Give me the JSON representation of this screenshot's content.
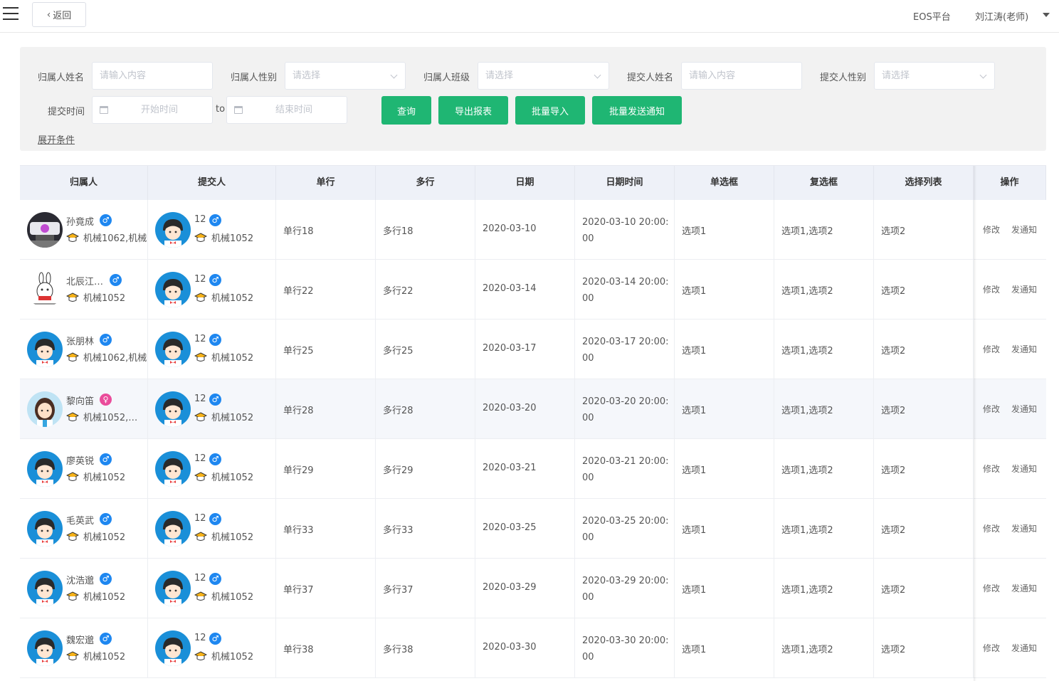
{
  "topbar": {
    "back_label": "返回",
    "platform": "EOS平台",
    "user": "刘江涛(老师)"
  },
  "filters": {
    "owner_name_label": "归属人姓名",
    "owner_name_placeholder": "请输入内容",
    "owner_gender_label": "归属人性别",
    "owner_gender_placeholder": "请选择",
    "owner_class_label": "归属人班级",
    "owner_class_placeholder": "请选择",
    "submitter_name_label": "提交人姓名",
    "submitter_name_placeholder": "请输入内容",
    "submitter_gender_label": "提交人性别",
    "submitter_gender_placeholder": "请选择",
    "submit_time_label": "提交时间",
    "start_placeholder": "开始时间",
    "to": "to",
    "end_placeholder": "结束时间",
    "expand_label": "展开条件"
  },
  "actions": {
    "query": "查询",
    "export": "导出报表",
    "import": "批量导入",
    "notify_all": "批量发送通知"
  },
  "table": {
    "headers": [
      "归属人",
      "提交人",
      "单行",
      "多行",
      "日期",
      "日期时间",
      "单选框",
      "复选框",
      "选择列表",
      "操作"
    ],
    "op_edit": "修改",
    "op_notify": "发通知",
    "rows": [
      {
        "owner": "孙竟成",
        "owner_gender": "♂",
        "owner_class": "机械1062,机械",
        "owner_avatar": "photo",
        "submitter": "12",
        "submitter_gender": "♂",
        "submitter_class": "机械1052",
        "single": "单行18",
        "multi": "多行18",
        "date": "2020-03-10",
        "datetime": "2020-03-10 20:00:00",
        "radio": "选项1",
        "checkbox": "选项1,选项2",
        "select": "选项2"
      },
      {
        "owner": "北辰江…",
        "owner_gender": "♂",
        "owner_class": "机械1052",
        "owner_avatar": "rabbit",
        "submitter": "12",
        "submitter_gender": "♂",
        "submitter_class": "机械1052",
        "single": "单行22",
        "multi": "多行22",
        "date": "2020-03-14",
        "datetime": "2020-03-14 20:00:00",
        "radio": "选项1",
        "checkbox": "选项1,选项2",
        "select": "选项2"
      },
      {
        "owner": "张朋林",
        "owner_gender": "♂",
        "owner_class": "机械1062,机械",
        "owner_avatar": "boy",
        "submitter": "12",
        "submitter_gender": "♂",
        "submitter_class": "机械1052",
        "single": "单行25",
        "multi": "多行25",
        "date": "2020-03-17",
        "datetime": "2020-03-17 20:00:00",
        "radio": "选项1",
        "checkbox": "选项1,选项2",
        "select": "选项2"
      },
      {
        "owner": "黎向笛",
        "owner_gender": "♀",
        "owner_class": "机械1052,…",
        "owner_avatar": "girl",
        "submitter": "12",
        "submitter_gender": "♂",
        "submitter_class": "机械1052",
        "single": "单行28",
        "multi": "多行28",
        "date": "2020-03-20",
        "datetime": "2020-03-20 20:00:00",
        "radio": "选项1",
        "checkbox": "选项1,选项2",
        "select": "选项2"
      },
      {
        "owner": "廖英锐",
        "owner_gender": "♂",
        "owner_class": "机械1052",
        "owner_avatar": "boy",
        "submitter": "12",
        "submitter_gender": "♂",
        "submitter_class": "机械1052",
        "single": "单行29",
        "multi": "多行29",
        "date": "2020-03-21",
        "datetime": "2020-03-21 20:00:00",
        "radio": "选项1",
        "checkbox": "选项1,选项2",
        "select": "选项2"
      },
      {
        "owner": "毛英武",
        "owner_gender": "♂",
        "owner_class": "机械1052",
        "owner_avatar": "boy",
        "submitter": "12",
        "submitter_gender": "♂",
        "submitter_class": "机械1052",
        "single": "单行33",
        "multi": "多行33",
        "date": "2020-03-25",
        "datetime": "2020-03-25 20:00:00",
        "radio": "选项1",
        "checkbox": "选项1,选项2",
        "select": "选项2"
      },
      {
        "owner": "沈浩邈",
        "owner_gender": "♂",
        "owner_class": "机械1052",
        "owner_avatar": "boy",
        "submitter": "12",
        "submitter_gender": "♂",
        "submitter_class": "机械1052",
        "single": "单行37",
        "multi": "多行37",
        "date": "2020-03-29",
        "datetime": "2020-03-29 20:00:00",
        "radio": "选项1",
        "checkbox": "选项1,选项2",
        "select": "选项2"
      },
      {
        "owner": "魏宏邈",
        "owner_gender": "♂",
        "owner_class": "机械1052",
        "owner_avatar": "boy",
        "submitter": "12",
        "submitter_gender": "♂",
        "submitter_class": "机械1052",
        "single": "单行38",
        "multi": "多行38",
        "date": "2020-03-30",
        "datetime": "2020-03-30 20:00:00",
        "radio": "选项1",
        "checkbox": "选项1,选项2",
        "select": "选项2"
      }
    ]
  },
  "colors": {
    "primary": "#1fb673",
    "male": "#1e87f0",
    "female": "#ea4c9b",
    "header_bg": "#eef1f8",
    "avatar_bg": "#1a8fd8"
  }
}
